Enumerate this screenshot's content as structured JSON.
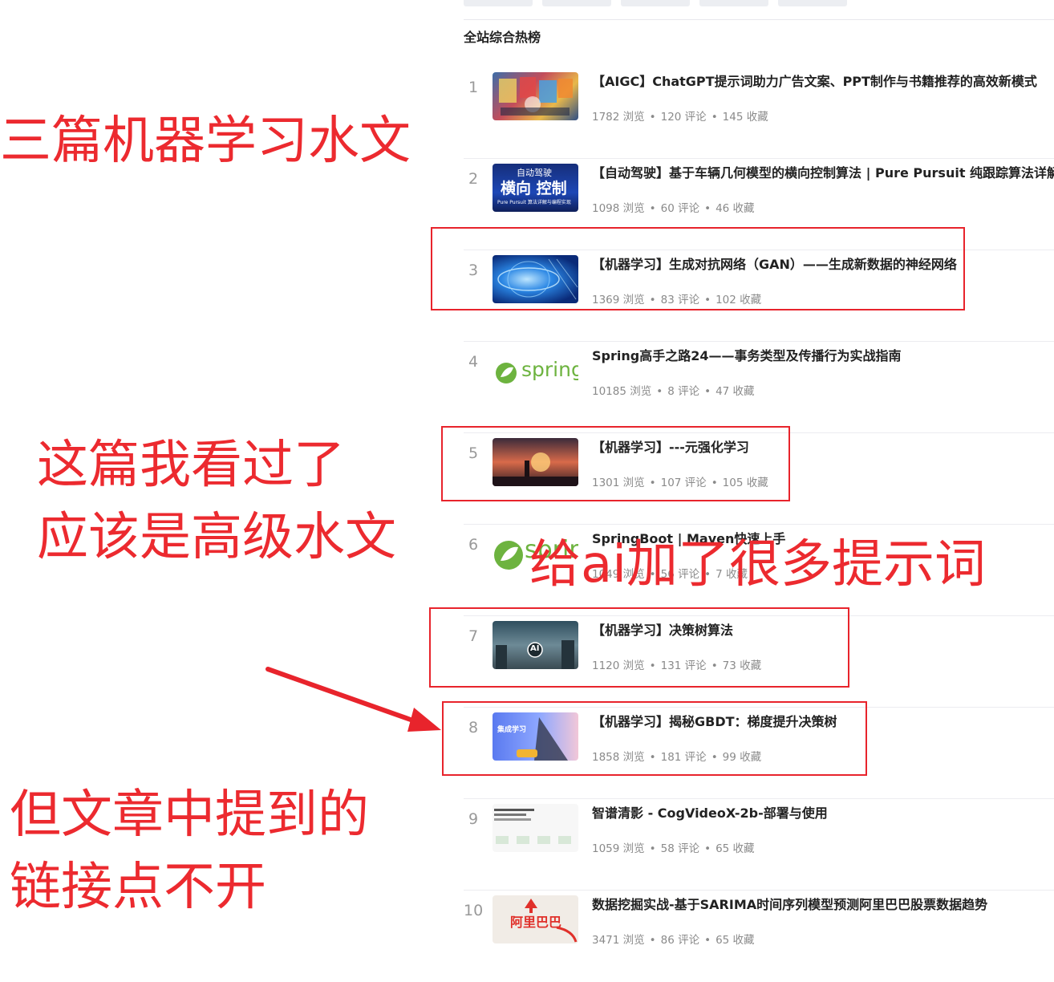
{
  "section_title": "全站综合热榜",
  "articles": [
    {
      "rank": "1",
      "title": "【AIGC】ChatGPT提示词助力广告文案、PPT制作与书籍推荐的高效新模式",
      "views": "1782 浏览",
      "comments": "120 评论",
      "favorites": "145 收藏"
    },
    {
      "rank": "2",
      "title": "【自动驾驶】基于车辆几何模型的横向控制算法 | Pure Pursuit 纯跟踪算法详解与",
      "views": "1098 浏览",
      "comments": "60 评论",
      "favorites": "46 收藏",
      "thumb_line1": "自动驾驶",
      "thumb_line2": "横向 控制",
      "thumb_line3": "Pure Pursuit 算法详解与编程实现"
    },
    {
      "rank": "3",
      "title": "【机器学习】生成对抗网络（GAN）——生成新数据的神经网络",
      "views": "1369 浏览",
      "comments": "83 评论",
      "favorites": "102 收藏"
    },
    {
      "rank": "4",
      "title": "Spring高手之路24——事务类型及传播行为实战指南",
      "views": "10185 浏览",
      "comments": "8 评论",
      "favorites": "47 收藏",
      "thumb_text": "spring"
    },
    {
      "rank": "5",
      "title": "【机器学习】---元强化学习",
      "views": "1301 浏览",
      "comments": "107 评论",
      "favorites": "105 收藏"
    },
    {
      "rank": "6",
      "title": "SpringBoot | Maven快速上手",
      "views": "1049 浏览",
      "comments": "56 评论",
      "favorites": "7 收藏",
      "thumb_text": "spring"
    },
    {
      "rank": "7",
      "title": "【机器学习】决策树算法",
      "views": "1120 浏览",
      "comments": "131 评论",
      "favorites": "73 收藏",
      "thumb_text": "AI"
    },
    {
      "rank": "8",
      "title": "【机器学习】揭秘GBDT：梯度提升决策树",
      "views": "1858 浏览",
      "comments": "181 评论",
      "favorites": "99 收藏",
      "thumb_text": "集成学习"
    },
    {
      "rank": "9",
      "title": "智谱清影 - CogVideoX-2b-部署与使用",
      "views": "1059 浏览",
      "comments": "58 评论",
      "favorites": "65 收藏"
    },
    {
      "rank": "10",
      "title": "数据挖掘实战-基于SARIMA时间序列模型预测阿里巴巴股票数据趋势",
      "views": "3471 浏览",
      "comments": "86 评论",
      "favorites": "65 收藏",
      "thumb_text": "阿里巴巴"
    }
  ],
  "annotations": {
    "note1": "三篇机器学习水文",
    "note2_line1": "这篇我看过了",
    "note2_line2": "应该是高级水文",
    "note3": "给ai加了很多提示词",
    "note4_line1": "但文章中提到的",
    "note4_line2": "链接点不开"
  },
  "colors": {
    "annotation_red": "#e8242c",
    "meta_gray": "#8a8a8a",
    "rank_gray": "#999999",
    "spring_green": "#6db33f"
  }
}
